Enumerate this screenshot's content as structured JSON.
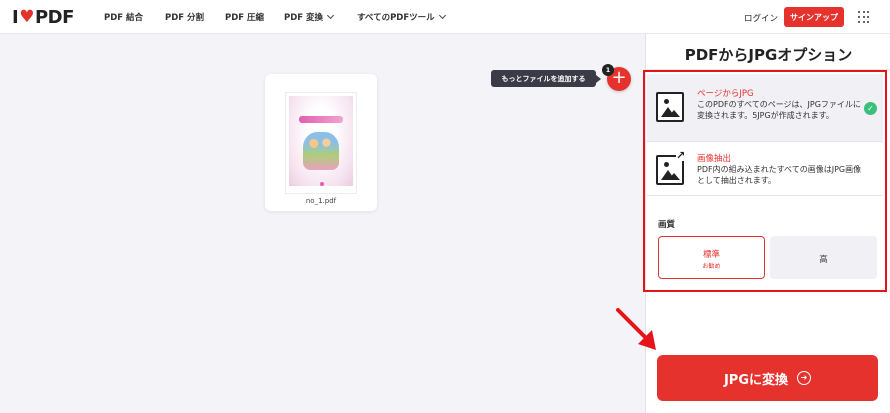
{
  "brand": {
    "logo_left": "I",
    "logo_right": "PDF",
    "accent": "#e5322d"
  },
  "nav": {
    "items": [
      {
        "label": "PDF 結合"
      },
      {
        "label": "PDF 分割"
      },
      {
        "label": "PDF 圧縮"
      },
      {
        "label": "PDF 変換",
        "dropdown": true
      },
      {
        "label": "すべてのPDFツール",
        "dropdown": true
      }
    ],
    "login": "ログイン",
    "signup": "サインアップ"
  },
  "workspace": {
    "file_name": "no_1.pdf",
    "tooltip": "もっとファイルを追加する",
    "file_count": "1",
    "add_icon": "plus-icon"
  },
  "sidebar": {
    "title": "PDFからJPGオプション",
    "options": [
      {
        "title": "ページからJPG",
        "desc": "このPDFのすべてのページは、JPGファイルに変換されます。5JPGが作成されます。",
        "selected": true,
        "icon": "image-icon"
      },
      {
        "title": "画像抽出",
        "desc": "PDF内の組み込まれたすべての画像はJPG画像として抽出されます。",
        "selected": false,
        "icon": "image-extract-icon"
      }
    ],
    "quality_label": "画質",
    "quality": [
      {
        "label": "標準",
        "sub": "お勧め",
        "selected": true
      },
      {
        "label": "高",
        "sub": "",
        "selected": false
      }
    ],
    "convert_label": "JPGに変換"
  },
  "colors": {
    "highlight_frame": "#e5141a",
    "success": "#3cbf7c"
  }
}
